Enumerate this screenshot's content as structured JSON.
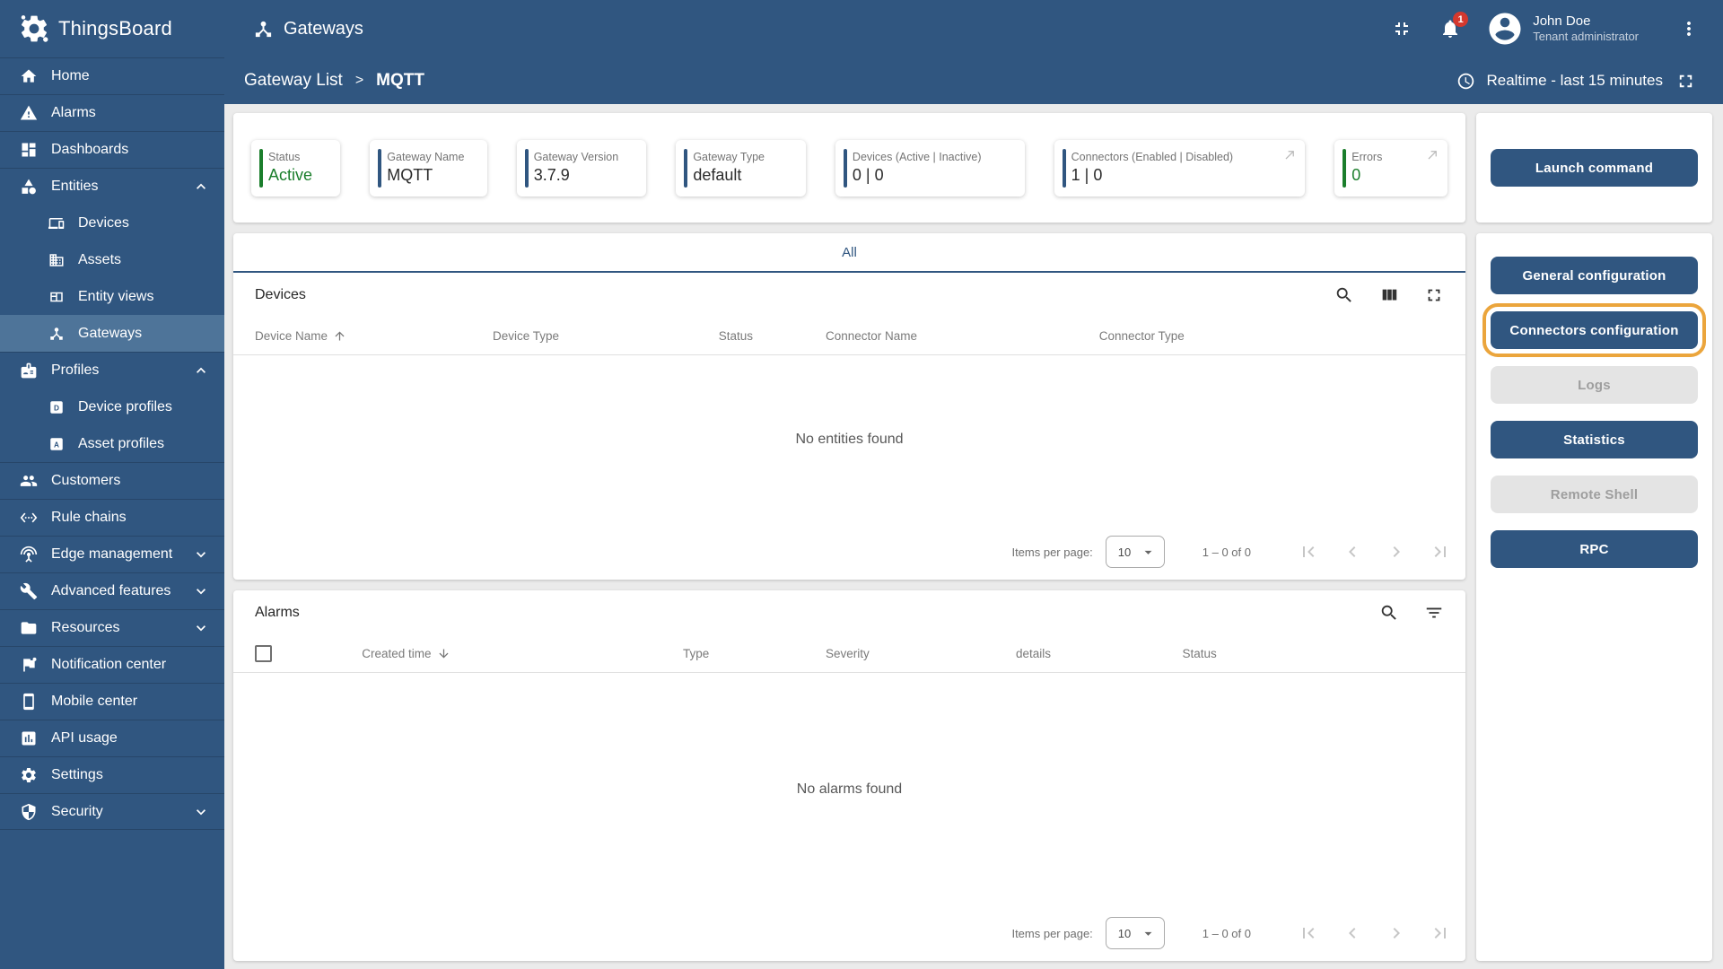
{
  "brand": {
    "name": "ThingsBoard"
  },
  "topbar": {
    "title": "Gateways",
    "notifications_badge": "1",
    "user": {
      "name": "John Doe",
      "role": "Tenant administrator"
    }
  },
  "breadcrumb": {
    "parent": "Gateway List",
    "separator": ">",
    "current": "MQTT",
    "time_window": "Realtime - last 15 minutes"
  },
  "sidebar": {
    "items": [
      {
        "label": "Home",
        "icon": "home-icon"
      },
      {
        "label": "Alarms",
        "icon": "warning-icon"
      },
      {
        "label": "Dashboards",
        "icon": "dashboards-icon"
      },
      {
        "label": "Entities",
        "icon": "entities-icon",
        "expanded": true
      },
      {
        "label": "Devices",
        "icon": "devices-icon"
      },
      {
        "label": "Assets",
        "icon": "assets-icon"
      },
      {
        "label": "Entity views",
        "icon": "entity-views-icon"
      },
      {
        "label": "Gateways",
        "icon": "gateways-icon",
        "selected": true
      },
      {
        "label": "Profiles",
        "icon": "profiles-icon",
        "expanded": true
      },
      {
        "label": "Device profiles",
        "icon": "device-profile-icon"
      },
      {
        "label": "Asset profiles",
        "icon": "asset-profile-icon"
      },
      {
        "label": "Customers",
        "icon": "customers-icon"
      },
      {
        "label": "Rule chains",
        "icon": "rule-chains-icon"
      },
      {
        "label": "Edge management",
        "icon": "edge-icon",
        "expanded": false
      },
      {
        "label": "Advanced features",
        "icon": "advanced-icon",
        "expanded": false
      },
      {
        "label": "Resources",
        "icon": "resources-icon",
        "expanded": false
      },
      {
        "label": "Notification center",
        "icon": "notification-icon"
      },
      {
        "label": "Mobile center",
        "icon": "mobile-icon"
      },
      {
        "label": "API usage",
        "icon": "api-usage-icon"
      },
      {
        "label": "Settings",
        "icon": "settings-icon"
      },
      {
        "label": "Security",
        "icon": "security-icon",
        "expanded": false
      }
    ]
  },
  "metrics": {
    "cards": [
      {
        "label": "Status",
        "value": "Active",
        "accent": "#1b7e2c",
        "link_arrow": false
      },
      {
        "label": "Gateway Name",
        "value": "MQTT",
        "accent": "#305680",
        "link_arrow": false
      },
      {
        "label": "Gateway Version",
        "value": "3.7.9",
        "accent": "#305680",
        "link_arrow": false
      },
      {
        "label": "Gateway Type",
        "value": "default",
        "accent": "#305680",
        "link_arrow": false
      },
      {
        "label": "Devices (Active | Inactive)",
        "value": "0 | 0",
        "accent": "#305680",
        "link_arrow": false
      },
      {
        "label": "Connectors (Enabled | Disabled)",
        "value": "1 | 0",
        "accent": "#305680",
        "link_arrow": true
      },
      {
        "label": "Errors",
        "value": "0",
        "accent": "#1b7e2c",
        "link_arrow": true
      }
    ]
  },
  "tabs": {
    "all_label": "All"
  },
  "devices_panel": {
    "title": "Devices",
    "columns": [
      "Device Name",
      "Device Type",
      "Status",
      "Connector Name",
      "Connector Type"
    ],
    "sort_column": "Device Name",
    "sort_direction": "asc",
    "empty_text": "No entities found",
    "pagination": {
      "items_per_page_label": "Items per page:",
      "page_size": "10",
      "range": "1 – 0 of 0"
    }
  },
  "alarms_panel": {
    "title": "Alarms",
    "columns": [
      "Created time",
      "Type",
      "Severity",
      "details",
      "Status"
    ],
    "sort_column": "Created time",
    "sort_direction": "desc",
    "empty_text": "No alarms found",
    "pagination": {
      "items_per_page_label": "Items per page:",
      "page_size": "10",
      "range": "1 – 0 of 0"
    }
  },
  "actions": {
    "launch_label": "Launch command",
    "buttons": [
      {
        "label": "General configuration",
        "disabled": false,
        "highlighted": false
      },
      {
        "label": "Connectors configuration",
        "disabled": false,
        "highlighted": true
      },
      {
        "label": "Logs",
        "disabled": true,
        "highlighted": false
      },
      {
        "label": "Statistics",
        "disabled": false,
        "highlighted": false
      },
      {
        "label": "Remote Shell",
        "disabled": true,
        "highlighted": false
      },
      {
        "label": "RPC",
        "disabled": false,
        "highlighted": false
      }
    ]
  },
  "colors": {
    "primary": "#305680",
    "sidebar_selected": "#4e7499",
    "status_green": "#1b7e2c",
    "highlight_orange": "#eba53c",
    "badge_red": "#d4382e",
    "disabled_bg": "#e4e4e4"
  }
}
